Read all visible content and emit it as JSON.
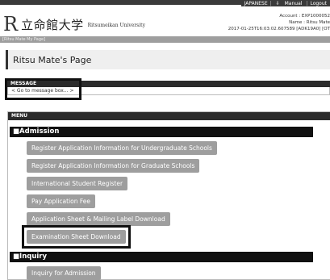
{
  "header": {
    "top_links": [
      "JAPANESE",
      "Manual",
      "Logout"
    ],
    "logo_mark": "R",
    "university_jp": "立命館大学",
    "university_en": "Ritsumeikan University",
    "account_line": "Account : EXP1000052",
    "name_line": "Name : Ritsu Mate",
    "session_line": "2017-01-25T16:03:02.607589 [ADK19A0] [OT"
  },
  "breadcrumb": "[Ritsu Mate My Page]",
  "page_title": "Ritsu Mate's Page",
  "message": {
    "heading": "MESSAGE",
    "link": "< Go to message box... >"
  },
  "menu": {
    "heading": "MENU",
    "admission": {
      "heading": "■Admission",
      "items": [
        "Register Application Information for Undergraduate Schools",
        "Register Application Information for Graduate Schools",
        "International Student Register",
        "Pay Application Fee",
        "Application Sheet & Mailing Label Download",
        "Examination Sheet Download"
      ]
    },
    "inquiry": {
      "heading": "■Inquiry",
      "items": [
        "Inquiry for Admission"
      ]
    }
  },
  "colors": {
    "header_dark": "#3a3a3a",
    "section_black": "#111111",
    "button_gray": "#9e9e9e"
  }
}
